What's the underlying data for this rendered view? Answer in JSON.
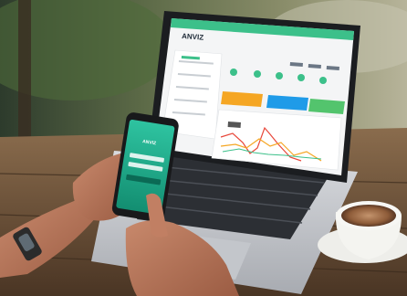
{
  "laptop": {
    "brand_logo": "ANVIZ",
    "colors": {
      "teal": "#3cc08a",
      "orange": "#f5a623",
      "blue": "#1f9be8",
      "green": "#53c46d"
    }
  },
  "phone": {
    "logo_label": "ANVIZ",
    "colors": {
      "screen": "#21b28f"
    }
  }
}
